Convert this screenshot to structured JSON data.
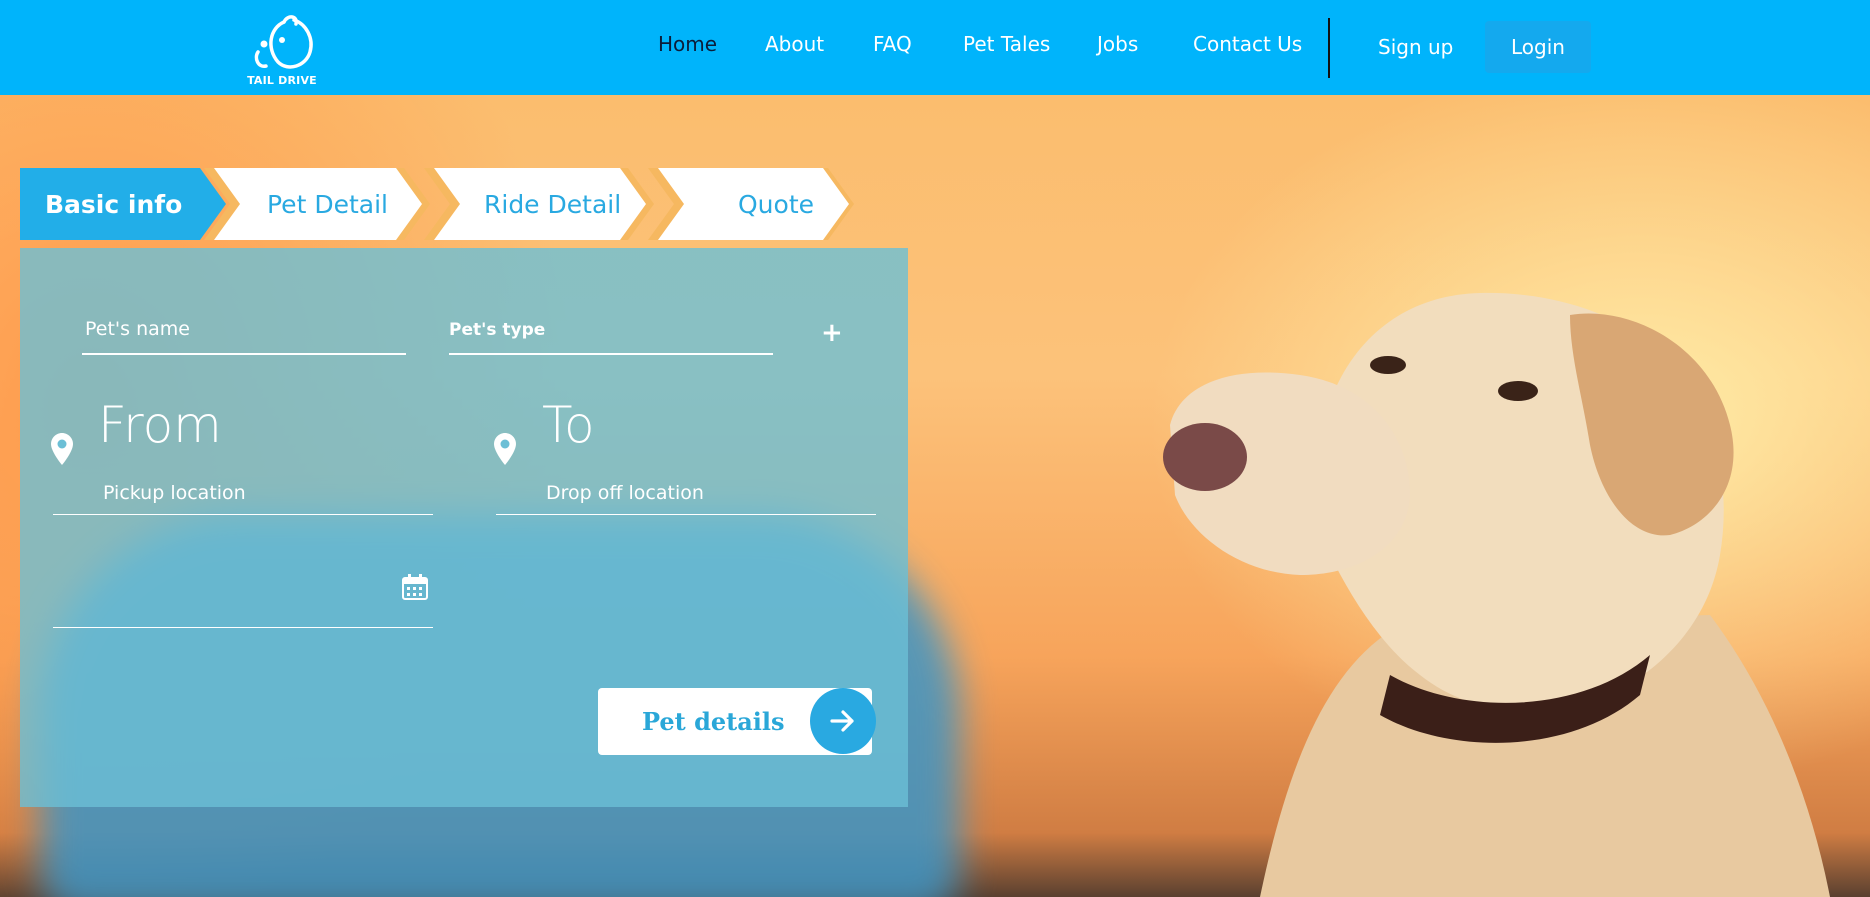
{
  "brand": {
    "name": "TAIL DRIVE"
  },
  "nav": {
    "items": [
      {
        "label": "Home"
      },
      {
        "label": "About"
      },
      {
        "label": "FAQ"
      },
      {
        "label": "Pet Tales"
      },
      {
        "label": "Jobs"
      },
      {
        "label": "Contact Us"
      }
    ],
    "signup": "Sign up",
    "login": "Login"
  },
  "steps": [
    {
      "label": "Basic info"
    },
    {
      "label": "Pet Detail"
    },
    {
      "label": "Ride Detail"
    },
    {
      "label": "Quote"
    }
  ],
  "form": {
    "pet_name_placeholder": "Pet's name",
    "pet_type_placeholder": "Pet's type",
    "add_label": "+",
    "from_label": "From",
    "pickup_placeholder": "Pickup location",
    "to_label": "To",
    "dropoff_placeholder": "Drop off location",
    "submit_label": "Pet details"
  },
  "colors": {
    "header_bg": "#00b4fb",
    "active_step": "#22aee8",
    "step_accent": "#f6b860",
    "panel": "#6cbfd6"
  },
  "icons": [
    "tail-drive-logo",
    "location-pin-icon",
    "calendar-icon",
    "arrow-right-icon"
  ]
}
